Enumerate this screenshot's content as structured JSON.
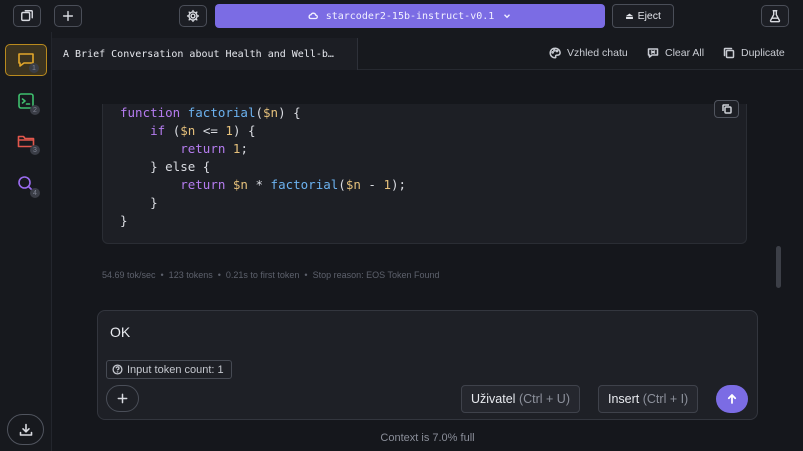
{
  "topbar": {
    "model_name": "starcoder2-15b-instruct-v0.1",
    "eject_label": "Eject"
  },
  "sidebar": {
    "items": [
      {
        "name": "chat",
        "badge": "1",
        "color": "#e3a72a"
      },
      {
        "name": "terminal",
        "badge": "2",
        "color": "#3fbf6f"
      },
      {
        "name": "folder",
        "badge": "3",
        "color": "#e2574c"
      },
      {
        "name": "search",
        "badge": "4",
        "color": "#9b6cf0"
      }
    ]
  },
  "tab": {
    "title": "A Brief Conversation about Health and Well-b…"
  },
  "tab_actions": {
    "appearance_label": "Vzhled chatu",
    "clear_label": "Clear All",
    "duplicate_label": "Duplicate"
  },
  "code": {
    "line1": {
      "kw": "function",
      "fn": "factorial",
      "open": "(",
      "var": "$n",
      "rest": ") {"
    },
    "line2": {
      "indent": "    ",
      "kw": "if",
      "open": " (",
      "var": "$n",
      "op": " <= ",
      "num": "1",
      "rest": ") {"
    },
    "line3": {
      "indent": "        ",
      "kw": "return",
      "sp": " ",
      "num": "1",
      "rest": ";"
    },
    "line4": {
      "text": "    } else {"
    },
    "line5": {
      "indent": "        ",
      "kw": "return",
      "sp": " ",
      "var": "$n",
      "op": " * ",
      "fn": "factorial",
      "open": "(",
      "var2": "$n",
      "op2": " - ",
      "num": "1",
      "rest": ");"
    },
    "line6": {
      "text": "    }"
    },
    "line7": {
      "text": "}"
    }
  },
  "stats": {
    "text": "54.69 tok/sec  •  123 tokens  •  0.21s to first token  •  Stop reason: EOS Token Found"
  },
  "input": {
    "value": "OK",
    "token_count": "Input token count: 1"
  },
  "buttons": {
    "user_label": "Uživatel",
    "user_hint": " (Ctrl + U)",
    "insert_label": "Insert",
    "insert_hint": " (Ctrl + I)"
  },
  "footer": {
    "context": "Context is 7.0% full"
  },
  "colors": {
    "accent": "#7b6ce4"
  }
}
